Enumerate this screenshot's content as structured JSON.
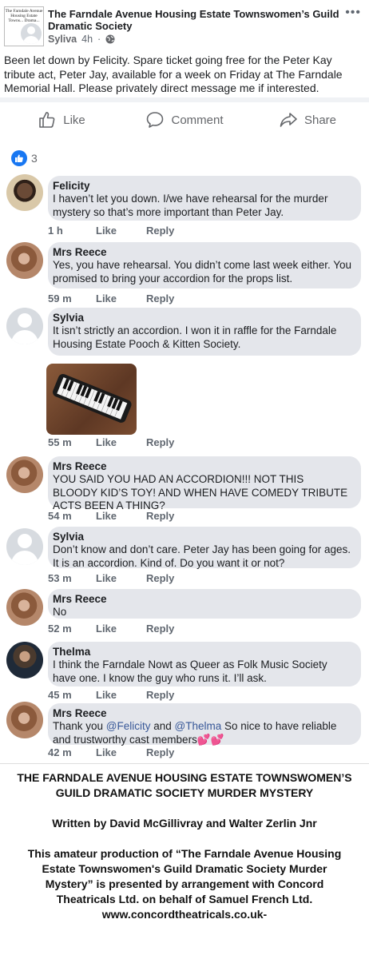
{
  "post": {
    "group_name": "The Farndale Avenue Housing Estate Townswomen’s Guild Dramatic Society",
    "logo_text": "The Farndale Avenue Housing Estate Towns... Drama...",
    "author": "Syliva",
    "time": "4h",
    "body": "Been let down by Felicity. Spare ticket going free for the Peter Kay tribute act, Peter Jay, available for a week on Friday at The Farndale Memorial Hall. Please privately direct message me if interested."
  },
  "actions": {
    "like": "Like",
    "comment": "Comment",
    "share": "Share"
  },
  "reactions": {
    "count": "3"
  },
  "comments": [
    {
      "name": "Felicity",
      "text": "I haven’t let you down. I/we have rehearsal for the murder mystery so that’s more important than Peter Jay.",
      "time": "1 h",
      "like": "Like",
      "reply": "Reply"
    },
    {
      "name": "Mrs Reece",
      "text": "Yes, you have rehearsal. You didn’t come last week either. You promised to bring your accordion for the props list.",
      "time": "59 m",
      "like": "Like",
      "reply": "Reply"
    },
    {
      "name": "Sylvia",
      "text": "It isn’t strictly an accordion. I won it in raffle for the Farndale Housing Estate Pooch & Kitten Society.",
      "time": "55 m",
      "like": "Like",
      "reply": "Reply"
    },
    {
      "name": "Mrs Reece",
      "text": "YOU SAID YOU HAD AN ACCORDION!!! NOT THIS BLOODY KID’S TOY! AND WHEN HAVE COMEDY TRIBUTE ACTS BEEN A THING?",
      "time": "54 m",
      "like": "Like",
      "reply": "Reply"
    },
    {
      "name": "Sylvia",
      "text": "Don’t know and don’t care. Peter Jay has been going for ages. It is an accordion. Kind of. Do you want it or not?",
      "time": "53 m",
      "like": "Like",
      "reply": "Reply"
    },
    {
      "name": "Mrs Reece",
      "text": "No",
      "time": "52 m",
      "like": "Like",
      "reply": "Reply"
    },
    {
      "name": "Thelma",
      "text": "I think the Farndale Nowt as Queer as Folk Music Society have one. I know the guy who runs it. I’ll ask.",
      "time": "45 m",
      "like": "Like",
      "reply": "Reply"
    },
    {
      "name": "Mrs Reece",
      "text_prefix": "Thank you ",
      "mention1": "@Felicity",
      "text_mid": " and ",
      "mention2": "@Thelma",
      "text_suffix": "   So nice to have reliable and trustworthy cast members",
      "emoji": "💕💕",
      "time": "42 m",
      "like": "Like",
      "reply": "Reply"
    }
  ],
  "credits": {
    "title": "THE FARNDALE AVENUE HOUSING ESTATE TOWNSWOMEN’S GUILD DRAMATIC SOCIETY MURDER MYSTERY",
    "authors": "Written by David McGillivray and Walter Zerlin Jnr",
    "licence": "This amateur production of “The Farndale Avenue Housing Estate Townswomen's Guild Dramatic Society Murder Mystery” is presented by arrangement with Concord Theatricals Ltd. on behalf of Samuel French Ltd. www.concordtheatricals.co.uk-"
  }
}
